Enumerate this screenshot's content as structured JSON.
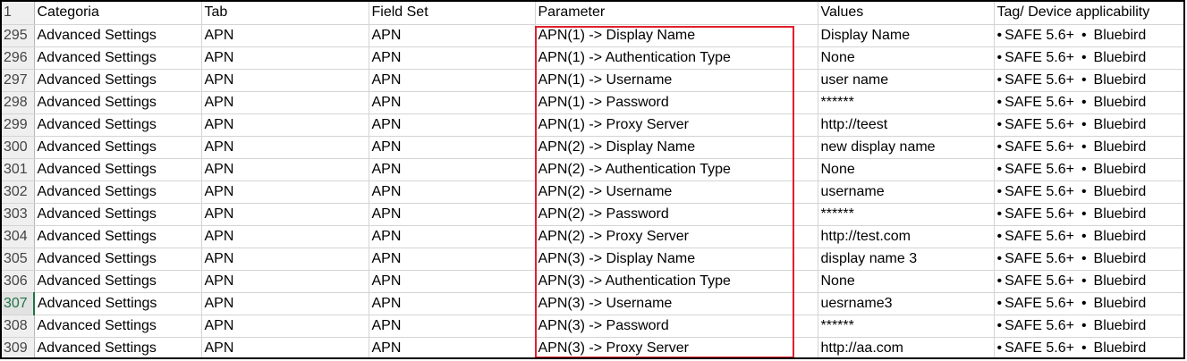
{
  "header": {
    "rownum": "1",
    "categoria": "Categoria",
    "tab": "Tab",
    "field_set": "Field Set",
    "parameter": "Parameter",
    "values": "Values",
    "tag": "Tag/ Device applicability"
  },
  "rows": [
    {
      "num": "295",
      "categoria": "Advanced Settings",
      "tab": "APN",
      "field_set": "APN",
      "parameter": "APN(1)  -> Display Name",
      "value": "Display Name",
      "tag1": "SAFE 5.6+",
      "tag2": "Bluebird"
    },
    {
      "num": "296",
      "categoria": "Advanced Settings",
      "tab": "APN",
      "field_set": "APN",
      "parameter": "APN(1)  -> Authentication Type",
      "value": "None",
      "tag1": "SAFE 5.6+",
      "tag2": "Bluebird"
    },
    {
      "num": "297",
      "categoria": "Advanced Settings",
      "tab": "APN",
      "field_set": "APN",
      "parameter": "APN(1)  -> Username",
      "value": "user name",
      "tag1": "SAFE 5.6+",
      "tag2": "Bluebird"
    },
    {
      "num": "298",
      "categoria": "Advanced Settings",
      "tab": "APN",
      "field_set": "APN",
      "parameter": "APN(1)  -> Password",
      "value": "******",
      "tag1": "SAFE 5.6+",
      "tag2": "Bluebird"
    },
    {
      "num": "299",
      "categoria": "Advanced Settings",
      "tab": "APN",
      "field_set": "APN",
      "parameter": "APN(1)  -> Proxy Server",
      "value": "http://teest",
      "tag1": "SAFE 5.6+",
      "tag2": "Bluebird"
    },
    {
      "num": "300",
      "categoria": "Advanced Settings",
      "tab": "APN",
      "field_set": "APN",
      "parameter": "APN(2)  -> Display Name",
      "value": "new display name",
      "tag1": "SAFE 5.6+",
      "tag2": "Bluebird"
    },
    {
      "num": "301",
      "categoria": "Advanced Settings",
      "tab": "APN",
      "field_set": "APN",
      "parameter": "APN(2)  -> Authentication Type",
      "value": "None",
      "tag1": "SAFE 5.6+",
      "tag2": "Bluebird"
    },
    {
      "num": "302",
      "categoria": "Advanced Settings",
      "tab": "APN",
      "field_set": "APN",
      "parameter": "APN(2)  -> Username",
      "value": "username",
      "tag1": "SAFE 5.6+",
      "tag2": "Bluebird"
    },
    {
      "num": "303",
      "categoria": "Advanced Settings",
      "tab": "APN",
      "field_set": "APN",
      "parameter": "APN(2)  -> Password",
      "value": "******",
      "tag1": "SAFE 5.6+",
      "tag2": "Bluebird"
    },
    {
      "num": "304",
      "categoria": "Advanced Settings",
      "tab": "APN",
      "field_set": "APN",
      "parameter": "APN(2)  -> Proxy Server",
      "value": "http://test.com",
      "tag1": "SAFE 5.6+",
      "tag2": "Bluebird"
    },
    {
      "num": "305",
      "categoria": "Advanced Settings",
      "tab": "APN",
      "field_set": "APN",
      "parameter": "APN(3)  -> Display Name",
      "value": "display name 3",
      "tag1": "SAFE 5.6+",
      "tag2": "Bluebird"
    },
    {
      "num": "306",
      "categoria": "Advanced Settings",
      "tab": "APN",
      "field_set": "APN",
      "parameter": "APN(3)  -> Authentication Type",
      "value": "None",
      "tag1": "SAFE 5.6+",
      "tag2": "Bluebird"
    },
    {
      "num": "307",
      "categoria": "Advanced Settings",
      "tab": "APN",
      "field_set": "APN",
      "parameter": "APN(3)  -> Username",
      "value": "uesrname3",
      "tag1": "SAFE 5.6+",
      "tag2": "Bluebird"
    },
    {
      "num": "308",
      "categoria": "Advanced Settings",
      "tab": "APN",
      "field_set": "APN",
      "parameter": "APN(3)  -> Password",
      "value": "******",
      "tag1": "SAFE 5.6+",
      "tag2": "Bluebird"
    },
    {
      "num": "309",
      "categoria": "Advanced Settings",
      "tab": "APN",
      "field_set": "APN",
      "parameter": "APN(3)  -> Proxy Server",
      "value": "http://aa.com",
      "tag1": "SAFE 5.6+",
      "tag2": "Bluebird"
    }
  ],
  "active_row": "307",
  "bullet": "•",
  "colors": {
    "highlight_box": "#e0202d",
    "active_row_number": "#217346",
    "gridline": "#d4d4d4"
  }
}
